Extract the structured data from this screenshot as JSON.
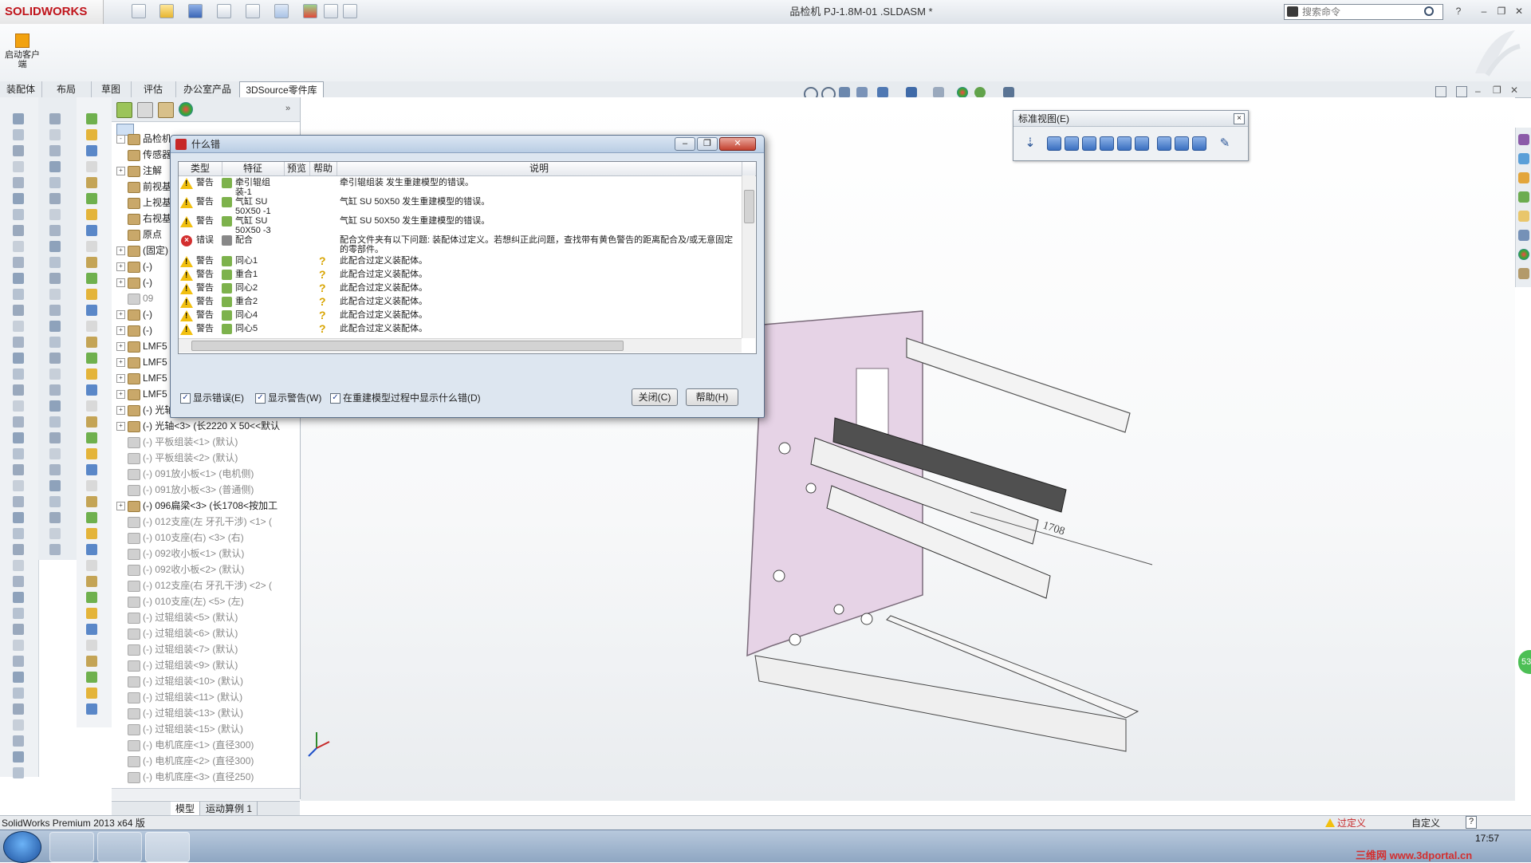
{
  "app": {
    "logo": "SOLIDWORKS",
    "document_title": "品检机 PJ-1.8M-01 .SLDASM *",
    "search_placeholder": "搜索命令",
    "help": "?",
    "min": "–",
    "restore": "❐",
    "close": "✕"
  },
  "command_manager": {
    "launch_label": "启动客户端",
    "tabs": [
      {
        "label": "装配体"
      },
      {
        "label": "布局"
      },
      {
        "label": "草图"
      },
      {
        "label": "评估"
      },
      {
        "label": "办公室产品"
      },
      {
        "label": "3DSource零件库"
      }
    ]
  },
  "feature_tree": {
    "rows": [
      {
        "label": "品检机",
        "grey": false,
        "expand": "-"
      },
      {
        "label": "传感器",
        "grey": false,
        "expand": ""
      },
      {
        "label": "注解",
        "grey": false,
        "expand": "+"
      },
      {
        "label": "前视基准面",
        "grey": false,
        "expand": ""
      },
      {
        "label": "上视基准面",
        "grey": false,
        "expand": ""
      },
      {
        "label": "右视基准面",
        "grey": false,
        "expand": ""
      },
      {
        "label": "原点",
        "grey": false,
        "expand": ""
      },
      {
        "label": "(固定)",
        "grey": false,
        "expand": "+"
      },
      {
        "label": "(-)",
        "grey": false,
        "expand": "+"
      },
      {
        "label": "(-)",
        "grey": false,
        "expand": "+"
      },
      {
        "label": "09",
        "grey": true,
        "expand": ""
      },
      {
        "label": "(-)",
        "grey": false,
        "expand": "+"
      },
      {
        "label": "(-)",
        "grey": false,
        "expand": "+"
      },
      {
        "label": "LMF5",
        "grey": false,
        "expand": "+"
      },
      {
        "label": "LMF5",
        "grey": false,
        "expand": "+"
      },
      {
        "label": "LMF5",
        "grey": false,
        "expand": "+"
      },
      {
        "label": "LMF5",
        "grey": false,
        "expand": "+"
      },
      {
        "label": "(-) 光轴<2> (长2220 X 50<<默认",
        "grey": false,
        "expand": "+"
      },
      {
        "label": "(-) 光轴<3> (长2220 X 50<<默认",
        "grey": false,
        "expand": "+"
      },
      {
        "label": "(-) 平板组装<1> (默认)",
        "grey": true,
        "expand": ""
      },
      {
        "label": "(-) 平板组装<2> (默认)",
        "grey": true,
        "expand": ""
      },
      {
        "label": "(-) 091放小板<1> (电机侧)",
        "grey": true,
        "expand": ""
      },
      {
        "label": "(-) 091放小板<3> (普通侧)",
        "grey": true,
        "expand": ""
      },
      {
        "label": "(-) 096扁梁<3> (长1708<按加工",
        "grey": false,
        "expand": "+"
      },
      {
        "label": "(-) 012支座(左 牙孔干涉) <1> (",
        "grey": true,
        "expand": ""
      },
      {
        "label": "(-) 010支座(右) <3> (右)",
        "grey": true,
        "expand": ""
      },
      {
        "label": "(-) 092收小板<1> (默认)",
        "grey": true,
        "expand": ""
      },
      {
        "label": "(-) 092收小板<2> (默认)",
        "grey": true,
        "expand": ""
      },
      {
        "label": "(-) 012支座(右 牙孔干涉) <2> (",
        "grey": true,
        "expand": ""
      },
      {
        "label": "(-) 010支座(左) <5> (左)",
        "grey": true,
        "expand": ""
      },
      {
        "label": "(-) 过辊组装<5> (默认)",
        "grey": true,
        "expand": ""
      },
      {
        "label": "(-) 过辊组装<6> (默认)",
        "grey": true,
        "expand": ""
      },
      {
        "label": "(-) 过辊组装<7> (默认)",
        "grey": true,
        "expand": ""
      },
      {
        "label": "(-) 过辊组装<9> (默认)",
        "grey": true,
        "expand": ""
      },
      {
        "label": "(-) 过辊组装<10> (默认)",
        "grey": true,
        "expand": ""
      },
      {
        "label": "(-) 过辊组装<11> (默认)",
        "grey": true,
        "expand": ""
      },
      {
        "label": "(-) 过辊组装<13> (默认)",
        "grey": true,
        "expand": ""
      },
      {
        "label": "(-) 过辊组装<15> (默认)",
        "grey": true,
        "expand": ""
      },
      {
        "label": "(-) 电机底座<1> (直径300)",
        "grey": true,
        "expand": ""
      },
      {
        "label": "(-) 电机底座<2> (直径300)",
        "grey": true,
        "expand": ""
      },
      {
        "label": "(-) 电机底座<3> (直径250)",
        "grey": true,
        "expand": ""
      }
    ],
    "bottom_tabs": [
      {
        "label": "模型"
      },
      {
        "label": "运动算例 1"
      }
    ]
  },
  "std_views": {
    "title": "标准视图(E)",
    "close": "×"
  },
  "dialog": {
    "title": "什么错",
    "columns": {
      "type": "类型",
      "feature": "特征",
      "preview": "预览",
      "help": "帮助",
      "desc": "说明"
    },
    "rows": [
      {
        "kind": "warn",
        "type": "警告",
        "feature": "牵引辊组装-1",
        "help": "",
        "desc": "牵引辊组装 发生重建模型的错误。"
      },
      {
        "kind": "warn",
        "type": "警告",
        "feature": "气缸 SU 50X50 -1",
        "help": "",
        "desc": "气缸 SU 50X50 发生重建模型的错误。"
      },
      {
        "kind": "warn",
        "type": "警告",
        "feature": "气缸 SU 50X50 -3",
        "help": "",
        "desc": "气缸 SU 50X50 发生重建模型的错误。"
      },
      {
        "kind": "err",
        "type": "错误",
        "feature": "配合",
        "help": "",
        "desc": "配合文件夹有以下问题: 装配体过定义。若想纠正此问题，查找带有黄色警告的距离配合及/或无意固定的零部件。"
      },
      {
        "kind": "warn",
        "type": "警告",
        "feature": "同心1",
        "help": "?",
        "desc": "此配合过定义装配体。"
      },
      {
        "kind": "warn",
        "type": "警告",
        "feature": "重合1",
        "help": "?",
        "desc": "此配合过定义装配体。"
      },
      {
        "kind": "warn",
        "type": "警告",
        "feature": "同心2",
        "help": "?",
        "desc": "此配合过定义装配体。"
      },
      {
        "kind": "warn",
        "type": "警告",
        "feature": "重合2",
        "help": "?",
        "desc": "此配合过定义装配体。"
      },
      {
        "kind": "warn",
        "type": "警告",
        "feature": "同心4",
        "help": "?",
        "desc": "此配合过定义装配体。"
      },
      {
        "kind": "warn",
        "type": "警告",
        "feature": "同心5",
        "help": "?",
        "desc": "此配合过定义装配体。"
      }
    ],
    "show_errors": "显示错误(E)",
    "show_warnings": "显示警告(W)",
    "show_during_rebuild": "在重建模型过程中显示什么错(D)",
    "close_button": "关闭(C)",
    "help_button": "帮助(H)"
  },
  "viewport": {
    "dimension_label": "1708",
    "badge": "53"
  },
  "status": {
    "version": "SolidWorks Premium 2013 x64 版",
    "state": "过定义",
    "custom": "自定义",
    "help": "?"
  },
  "taskbar": {
    "time": "17:57",
    "watermark": "三维网 www.3dportal.cn"
  }
}
